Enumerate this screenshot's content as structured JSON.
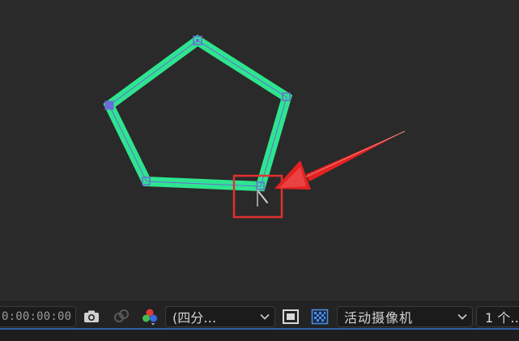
{
  "viewer": {
    "shape_color": "#2ee58f",
    "path_color": "#6b6bd9",
    "vertex_color": "#6b6bd9",
    "highlight_box_color": "#e03030",
    "arrow_color": "#e52121"
  },
  "toolbar": {
    "timecode": "0:00:00:00",
    "snapshot_icon": "camera-icon",
    "show_snapshot_icon": "snapshot-link-icon",
    "channel_icon": "rgb-channels-icon",
    "resolution_label": "(四分…",
    "region_icon": "region-of-interest-icon",
    "transparency_grid_icon": "transparency-grid-icon",
    "camera_label": "活动摄像机",
    "views_label": "1 个…",
    "accent_blue": "#2d5fa8"
  }
}
